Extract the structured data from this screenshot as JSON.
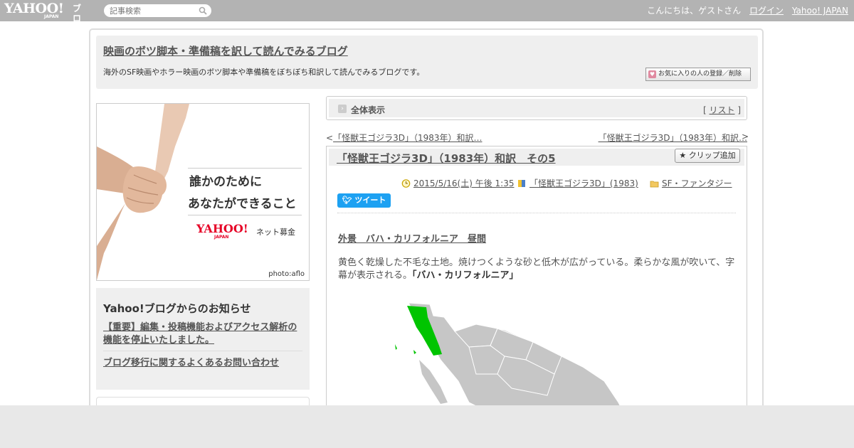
{
  "topbar": {
    "logo_text": "YAHOO!",
    "logo_sub": "JAPAN",
    "logo_blog": "ブログ",
    "search_placeholder": "記事検索",
    "greeting": "こんにちは、ゲストさん",
    "login": "ログイン",
    "yahoo_japan": "Yahoo! JAPAN"
  },
  "header": {
    "title": "映画のボツ脚本・準備稿を訳して読んでみるブログ",
    "description": "海外のSF映画やホラー映画のボツ脚本や準備稿をぼちぼち和訳して読んでみるブログです。",
    "fav_button": "お気に入りの人の登録／削除"
  },
  "banner": {
    "line1": "誰かのために",
    "line2": "あなたができること",
    "yahoo": "YAHOO!",
    "yahoo_sub": "JAPAN",
    "net": "ネット募金",
    "credit": "photo:aflo"
  },
  "notice": {
    "title": "Yahoo!ブログからのお知らせ",
    "link1": "【重要】編集・投稿機能およびアクセス解析の機能を停止いたしました。",
    "link2": "ブログ移行に関するよくあるお問い合わせ"
  },
  "viewbar": {
    "label": "全体表示",
    "list_open": "[ ",
    "list": "リスト",
    "list_close": " ]"
  },
  "nav": {
    "prev_arrow": "<",
    "prev": "「怪獣王ゴジラ3D」（1983年）和訳…",
    "next": "「怪獣王ゴジラ3D」（1983年）和訳…",
    "next_arrow": ">"
  },
  "article": {
    "title": "「怪獣王ゴジラ3D」（1983年）和訳　その5",
    "clip": "クリップ追加",
    "date": "2015/5/16(土) 午後 1:35",
    "book": "「怪獣王ゴジラ3D」(1983)",
    "category": "SF・ファンタジー",
    "tweet": "ツイート",
    "scene": "外景　バハ・カリフォルニア　昼間",
    "body": "黄色く乾燥した不毛な土地。焼けつくような砂と低木が広がっている。柔らかな風が吹いて、字幕が表示される。",
    "caption": "「バハ・カリフォルニア」"
  },
  "colors": {
    "topbar": "#b3b3b3",
    "map_highlight": "#00c400",
    "map_land": "#c6c6c6",
    "tweet": "#1da1f2"
  }
}
